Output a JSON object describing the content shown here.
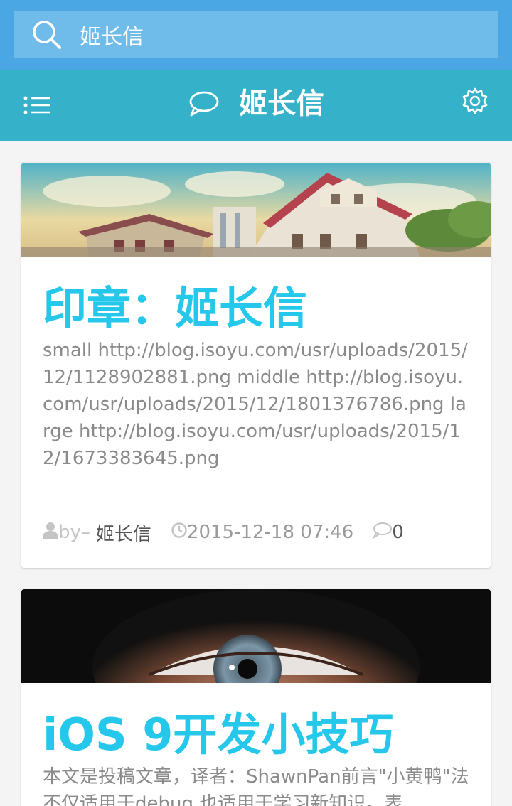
{
  "search": {
    "value": "姬长信"
  },
  "app_bar": {
    "title": "姬长信"
  },
  "posts": [
    {
      "title": "印章：姬长信",
      "excerpt": "small http://blog.isoyu.com/usr/uploads/2015/12/1128902881.png middle http://blog.isoyu.com/usr/uploads/2015/12/1801376786.png large http://blog.isoyu.com/usr/uploads/2015/12/1673383645.png",
      "by_label": "by–",
      "author": "姬长信",
      "date": "2015-12-18 07:46",
      "comments": "0"
    },
    {
      "title": "iOS 9开发小技巧",
      "excerpt": "本文是投稿文章，译者：ShawnPan前言\"小黄鸭\"法不仅适用于debug,也适用于学习新知识。表"
    }
  ],
  "colors": {
    "search_bar": "#4aa7e3",
    "app_bar": "#35b1c9",
    "title_accent": "#25c8ea"
  },
  "icons": [
    "search-icon",
    "menu-icon",
    "chat-icon",
    "gear-icon",
    "user-icon",
    "clock-icon",
    "comment-icon"
  ]
}
